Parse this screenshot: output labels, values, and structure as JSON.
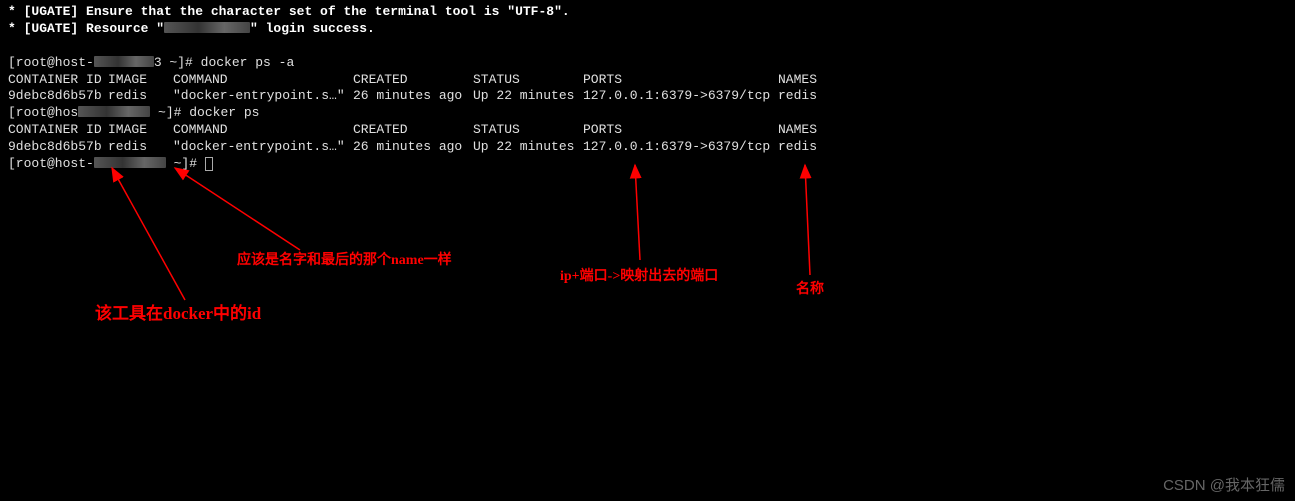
{
  "banner": {
    "line1": "* [UGATE] Ensure that the character set of the terminal tool is \"UTF-8\".",
    "line2_prefix": "* [UGATE] Resource \"",
    "line2_suffix": "\" login success."
  },
  "prompt1": {
    "user_host_prefix": "[root@host-",
    "user_host_suffix": "3 ~]# ",
    "command": "docker ps -a"
  },
  "table1": {
    "headers": {
      "container_id": "CONTAINER ID",
      "image": "IMAGE",
      "command": "COMMAND",
      "created": "CREATED",
      "status": "STATUS",
      "ports": "PORTS",
      "names": "NAMES"
    },
    "row": {
      "container_id": "9debc8d6b57b",
      "image": "redis",
      "command": "\"docker-entrypoint.s…\"",
      "created": "26 minutes ago",
      "status": "Up 22 minutes",
      "ports": "127.0.0.1:6379->6379/tcp",
      "names": "redis"
    }
  },
  "prompt2": {
    "user_host_prefix": "[root@hos",
    "user_host_suffix": " ~]# ",
    "command": "docker ps"
  },
  "table2": {
    "headers": {
      "container_id": "CONTAINER ID",
      "image": "IMAGE",
      "command": "COMMAND",
      "created": "CREATED",
      "status": "STATUS",
      "ports": "PORTS",
      "names": "NAMES"
    },
    "row": {
      "container_id": "9debc8d6b57b",
      "image": "redis",
      "command": "\"docker-entrypoint.s…\"",
      "created": "26 minutes ago",
      "status": "Up 22 minutes",
      "ports": "127.0.0.1:6379->6379/tcp",
      "names": "redis"
    }
  },
  "prompt3": {
    "user_host_prefix": "[root@host-",
    "user_host_suffix": " ~]# "
  },
  "annotations": {
    "a1": "该工具在docker中的id",
    "a2": "应该是名字和最后的那个name一样",
    "a3": "ip+端口->映射出去的端口",
    "a4": "名称"
  },
  "watermark": "CSDN @我本狂儒"
}
